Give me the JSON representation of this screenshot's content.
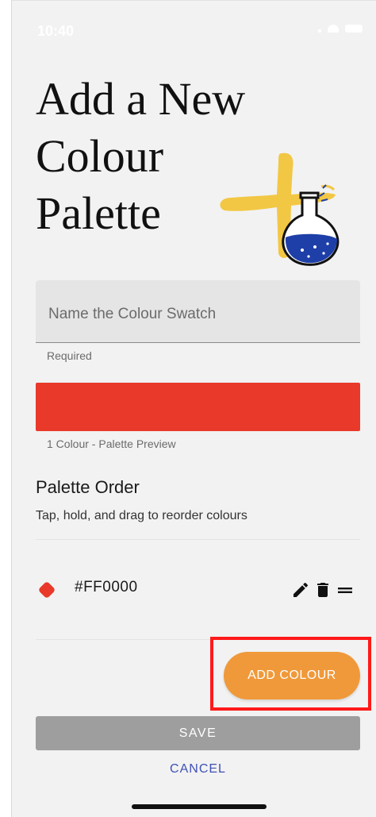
{
  "status_bar": {
    "time": "10:40"
  },
  "page": {
    "title_lines": [
      "Add a New",
      "Colour",
      "Palette"
    ]
  },
  "form": {
    "name_placeholder": "Name the Colour Swatch",
    "name_helper": "Required",
    "preview_caption": "1 Colour - Palette Preview",
    "preview_color": "#E8392A"
  },
  "palette_order": {
    "heading": "Palette Order",
    "hint": "Tap, hold, and drag to reorder colours",
    "swatches": [
      {
        "hex": "#FF0000",
        "dot_color": "#E8392A"
      }
    ],
    "row_icons": [
      "pencil-icon",
      "trash-icon",
      "drag-handle-icon"
    ]
  },
  "actions": {
    "add_colour": "ADD COLOUR",
    "save": "SAVE",
    "cancel": "CANCEL"
  },
  "colors": {
    "accent_orange": "#F0993A",
    "save_disabled": "#9E9E9E",
    "cancel_link": "#3F51B5",
    "highlight_outline": "#FF1A1A",
    "illustration_yellow": "#F2C744",
    "flask_blue": "#1F3FA8"
  }
}
